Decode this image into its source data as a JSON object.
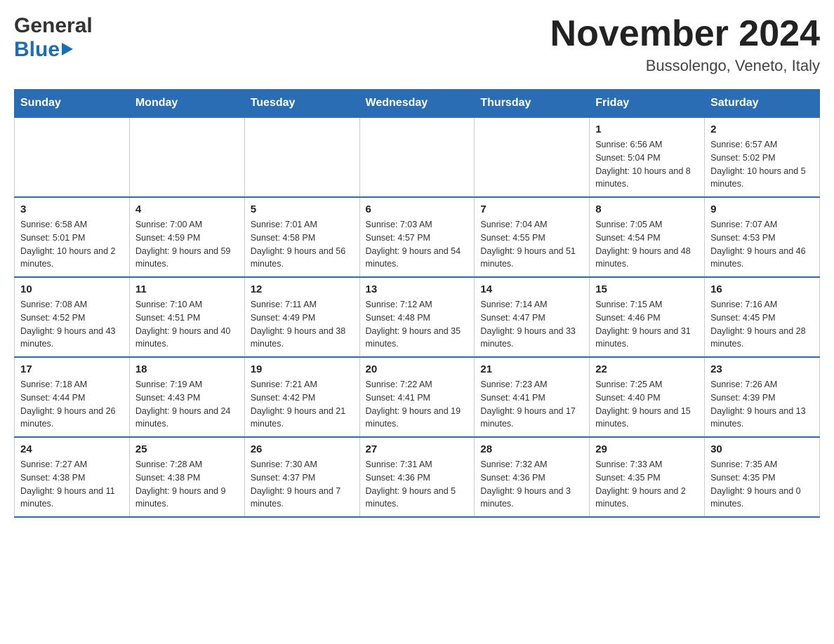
{
  "header": {
    "logo_general": "General",
    "logo_blue": "Blue",
    "month_title": "November 2024",
    "location": "Bussolengo, Veneto, Italy"
  },
  "days_of_week": [
    "Sunday",
    "Monday",
    "Tuesday",
    "Wednesday",
    "Thursday",
    "Friday",
    "Saturday"
  ],
  "weeks": [
    {
      "days": [
        {
          "number": "",
          "info": "",
          "empty": true
        },
        {
          "number": "",
          "info": "",
          "empty": true
        },
        {
          "number": "",
          "info": "",
          "empty": true
        },
        {
          "number": "",
          "info": "",
          "empty": true
        },
        {
          "number": "",
          "info": "",
          "empty": true
        },
        {
          "number": "1",
          "info": "Sunrise: 6:56 AM\nSunset: 5:04 PM\nDaylight: 10 hours and 8 minutes."
        },
        {
          "number": "2",
          "info": "Sunrise: 6:57 AM\nSunset: 5:02 PM\nDaylight: 10 hours and 5 minutes."
        }
      ]
    },
    {
      "days": [
        {
          "number": "3",
          "info": "Sunrise: 6:58 AM\nSunset: 5:01 PM\nDaylight: 10 hours and 2 minutes."
        },
        {
          "number": "4",
          "info": "Sunrise: 7:00 AM\nSunset: 4:59 PM\nDaylight: 9 hours and 59 minutes."
        },
        {
          "number": "5",
          "info": "Sunrise: 7:01 AM\nSunset: 4:58 PM\nDaylight: 9 hours and 56 minutes."
        },
        {
          "number": "6",
          "info": "Sunrise: 7:03 AM\nSunset: 4:57 PM\nDaylight: 9 hours and 54 minutes."
        },
        {
          "number": "7",
          "info": "Sunrise: 7:04 AM\nSunset: 4:55 PM\nDaylight: 9 hours and 51 minutes."
        },
        {
          "number": "8",
          "info": "Sunrise: 7:05 AM\nSunset: 4:54 PM\nDaylight: 9 hours and 48 minutes."
        },
        {
          "number": "9",
          "info": "Sunrise: 7:07 AM\nSunset: 4:53 PM\nDaylight: 9 hours and 46 minutes."
        }
      ]
    },
    {
      "days": [
        {
          "number": "10",
          "info": "Sunrise: 7:08 AM\nSunset: 4:52 PM\nDaylight: 9 hours and 43 minutes."
        },
        {
          "number": "11",
          "info": "Sunrise: 7:10 AM\nSunset: 4:51 PM\nDaylight: 9 hours and 40 minutes."
        },
        {
          "number": "12",
          "info": "Sunrise: 7:11 AM\nSunset: 4:49 PM\nDaylight: 9 hours and 38 minutes."
        },
        {
          "number": "13",
          "info": "Sunrise: 7:12 AM\nSunset: 4:48 PM\nDaylight: 9 hours and 35 minutes."
        },
        {
          "number": "14",
          "info": "Sunrise: 7:14 AM\nSunset: 4:47 PM\nDaylight: 9 hours and 33 minutes."
        },
        {
          "number": "15",
          "info": "Sunrise: 7:15 AM\nSunset: 4:46 PM\nDaylight: 9 hours and 31 minutes."
        },
        {
          "number": "16",
          "info": "Sunrise: 7:16 AM\nSunset: 4:45 PM\nDaylight: 9 hours and 28 minutes."
        }
      ]
    },
    {
      "days": [
        {
          "number": "17",
          "info": "Sunrise: 7:18 AM\nSunset: 4:44 PM\nDaylight: 9 hours and 26 minutes."
        },
        {
          "number": "18",
          "info": "Sunrise: 7:19 AM\nSunset: 4:43 PM\nDaylight: 9 hours and 24 minutes."
        },
        {
          "number": "19",
          "info": "Sunrise: 7:21 AM\nSunset: 4:42 PM\nDaylight: 9 hours and 21 minutes."
        },
        {
          "number": "20",
          "info": "Sunrise: 7:22 AM\nSunset: 4:41 PM\nDaylight: 9 hours and 19 minutes."
        },
        {
          "number": "21",
          "info": "Sunrise: 7:23 AM\nSunset: 4:41 PM\nDaylight: 9 hours and 17 minutes."
        },
        {
          "number": "22",
          "info": "Sunrise: 7:25 AM\nSunset: 4:40 PM\nDaylight: 9 hours and 15 minutes."
        },
        {
          "number": "23",
          "info": "Sunrise: 7:26 AM\nSunset: 4:39 PM\nDaylight: 9 hours and 13 minutes."
        }
      ]
    },
    {
      "days": [
        {
          "number": "24",
          "info": "Sunrise: 7:27 AM\nSunset: 4:38 PM\nDaylight: 9 hours and 11 minutes."
        },
        {
          "number": "25",
          "info": "Sunrise: 7:28 AM\nSunset: 4:38 PM\nDaylight: 9 hours and 9 minutes."
        },
        {
          "number": "26",
          "info": "Sunrise: 7:30 AM\nSunset: 4:37 PM\nDaylight: 9 hours and 7 minutes."
        },
        {
          "number": "27",
          "info": "Sunrise: 7:31 AM\nSunset: 4:36 PM\nDaylight: 9 hours and 5 minutes."
        },
        {
          "number": "28",
          "info": "Sunrise: 7:32 AM\nSunset: 4:36 PM\nDaylight: 9 hours and 3 minutes."
        },
        {
          "number": "29",
          "info": "Sunrise: 7:33 AM\nSunset: 4:35 PM\nDaylight: 9 hours and 2 minutes."
        },
        {
          "number": "30",
          "info": "Sunrise: 7:35 AM\nSunset: 4:35 PM\nDaylight: 9 hours and 0 minutes."
        }
      ]
    }
  ]
}
